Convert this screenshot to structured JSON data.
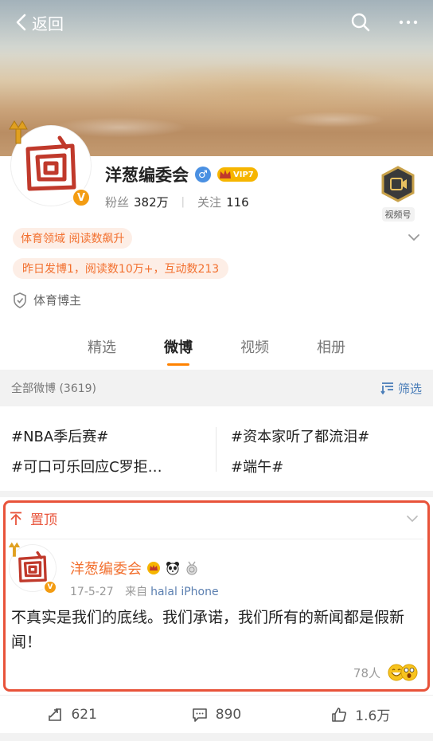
{
  "nav": {
    "back_label": "返回"
  },
  "profile": {
    "name": "洋葱编委会",
    "vip_label": "VIP7",
    "gender_symbol": "♂",
    "v_badge": "V",
    "fans_label": "粉丝",
    "fans_count": "382万",
    "follow_label": "关注",
    "follow_count": "116",
    "video_badge_label": "视频号",
    "tag_field": "体育领域 阅读数飙升",
    "tag_stats": "昨日发博1，阅读数10万+，互动数213",
    "certification": "体育博主"
  },
  "tabs": [
    {
      "label": "精选",
      "active": false
    },
    {
      "label": "微博",
      "active": true
    },
    {
      "label": "视频",
      "active": false
    },
    {
      "label": "相册",
      "active": false
    }
  ],
  "filter_bar": {
    "all_label": "全部微博 (3619)",
    "filter_label": "筛选"
  },
  "topics": [
    "#NBA季后赛#",
    "#资本家听了都流泪#",
    "#可口可乐回应C罗拒…",
    "#端午#"
  ],
  "pinned_post": {
    "pin_label": "置顶",
    "author": "洋葱编委会",
    "date": "17-5-27",
    "source_prefix": "来自",
    "source": "halal iPhone",
    "text": "不真实是我们的底线。我们承诺，我们所有的新闻都是假新闻！",
    "readers": "78人"
  },
  "actions": {
    "repost": "621",
    "comment": "890",
    "like": "1.6万"
  },
  "colors": {
    "accent": "#ff8200",
    "tag_text": "#f2702f",
    "link": "#4a7db8",
    "highlight_border": "#e8533a"
  }
}
